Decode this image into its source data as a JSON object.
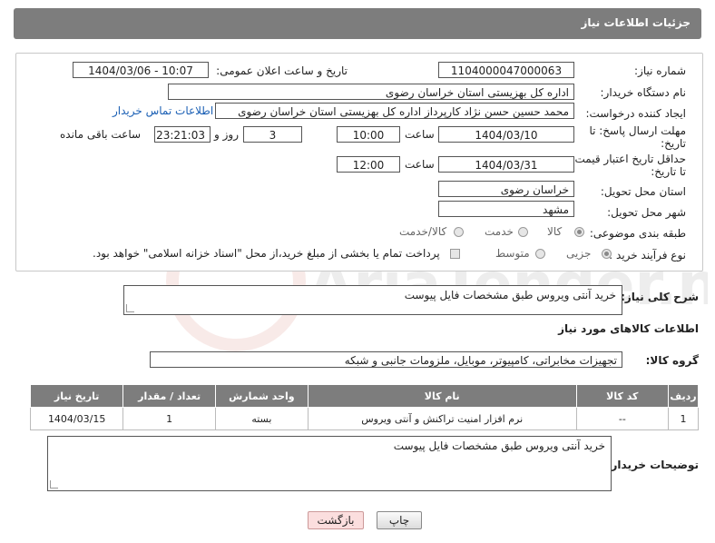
{
  "header": {
    "title": "جزئیات اطلاعات نیاز"
  },
  "form": {
    "need_number_label": "شماره نیاز:",
    "need_number": "1104000047000063",
    "announce_label": "تاریخ و ساعت اعلان عمومی:",
    "announce_value": "1404/03/06 - 10:07",
    "buyer_org_label": "نام دستگاه خریدار:",
    "buyer_org": "اداره کل بهزیستی استان خراسان رضوی",
    "creator_label": "ایجاد کننده درخواست:",
    "creator": "محمد حسین حسن نژاد کارپرداز اداره کل بهزیستی استان خراسان رضوی",
    "contact_link": "اطلاعات تماس خریدار",
    "deadline_label_1": "مهلت ارسال پاسخ: تا",
    "deadline_label_2": "تاریخ:",
    "deadline_date": "1404/03/10",
    "time_word": "ساعت",
    "deadline_time": "10:00",
    "days_value": "3",
    "days_and": "روز و",
    "remaining_time": "23:21:03",
    "remaining_label": "ساعت باقی مانده",
    "validity_label_1": "حداقل تاریخ اعتبار قیمت:",
    "validity_label_2": "تا تاریخ:",
    "validity_date": "1404/03/31",
    "validity_time": "12:00",
    "province_label": "استان محل تحویل:",
    "province": "خراسان رضوی",
    "city_label": "شهر محل تحویل:",
    "city": "مشهد",
    "category_label": "طبقه بندی موضوعی:",
    "category_options": [
      "کالا",
      "خدمت",
      "کالا/خدمت"
    ],
    "process_label": "نوع فرآیند خرید :",
    "process_options": [
      "جزیی",
      "متوسط"
    ],
    "payment_note": "پرداخت تمام یا بخشی از مبلغ خرید،از محل \"اسناد خزانه اسلامی\" خواهد بود."
  },
  "summary": {
    "label": "شرح کلی نیاز:",
    "text": "خرید آنتی ویروس طبق مشخصات فایل پیوست"
  },
  "goods": {
    "section_title": "اطلاعات کالاهای مورد نیاز",
    "group_label": "گروه کالا:",
    "group_value": "تجهیزات مخابراتی، کامپیوتر، موبایل، ملزومات جانبی و شبکه",
    "columns": [
      "ردیف",
      "کد کالا",
      "نام کالا",
      "واحد شمارش",
      "تعداد / مقدار",
      "تاریخ نیاز"
    ],
    "rows": [
      [
        "1",
        "--",
        "نرم افزار امنیت تراکنش و آنتی ویروس",
        "بسته",
        "1",
        "1404/03/15"
      ]
    ]
  },
  "buyer_notes": {
    "label": "توضیحات خریدار:",
    "text": "خرید آنتی ویروس طبق مشخصات فایل پیوست"
  },
  "buttons": {
    "print": "چاپ",
    "back": "بازگشت"
  },
  "watermark": "AriaTender.net"
}
